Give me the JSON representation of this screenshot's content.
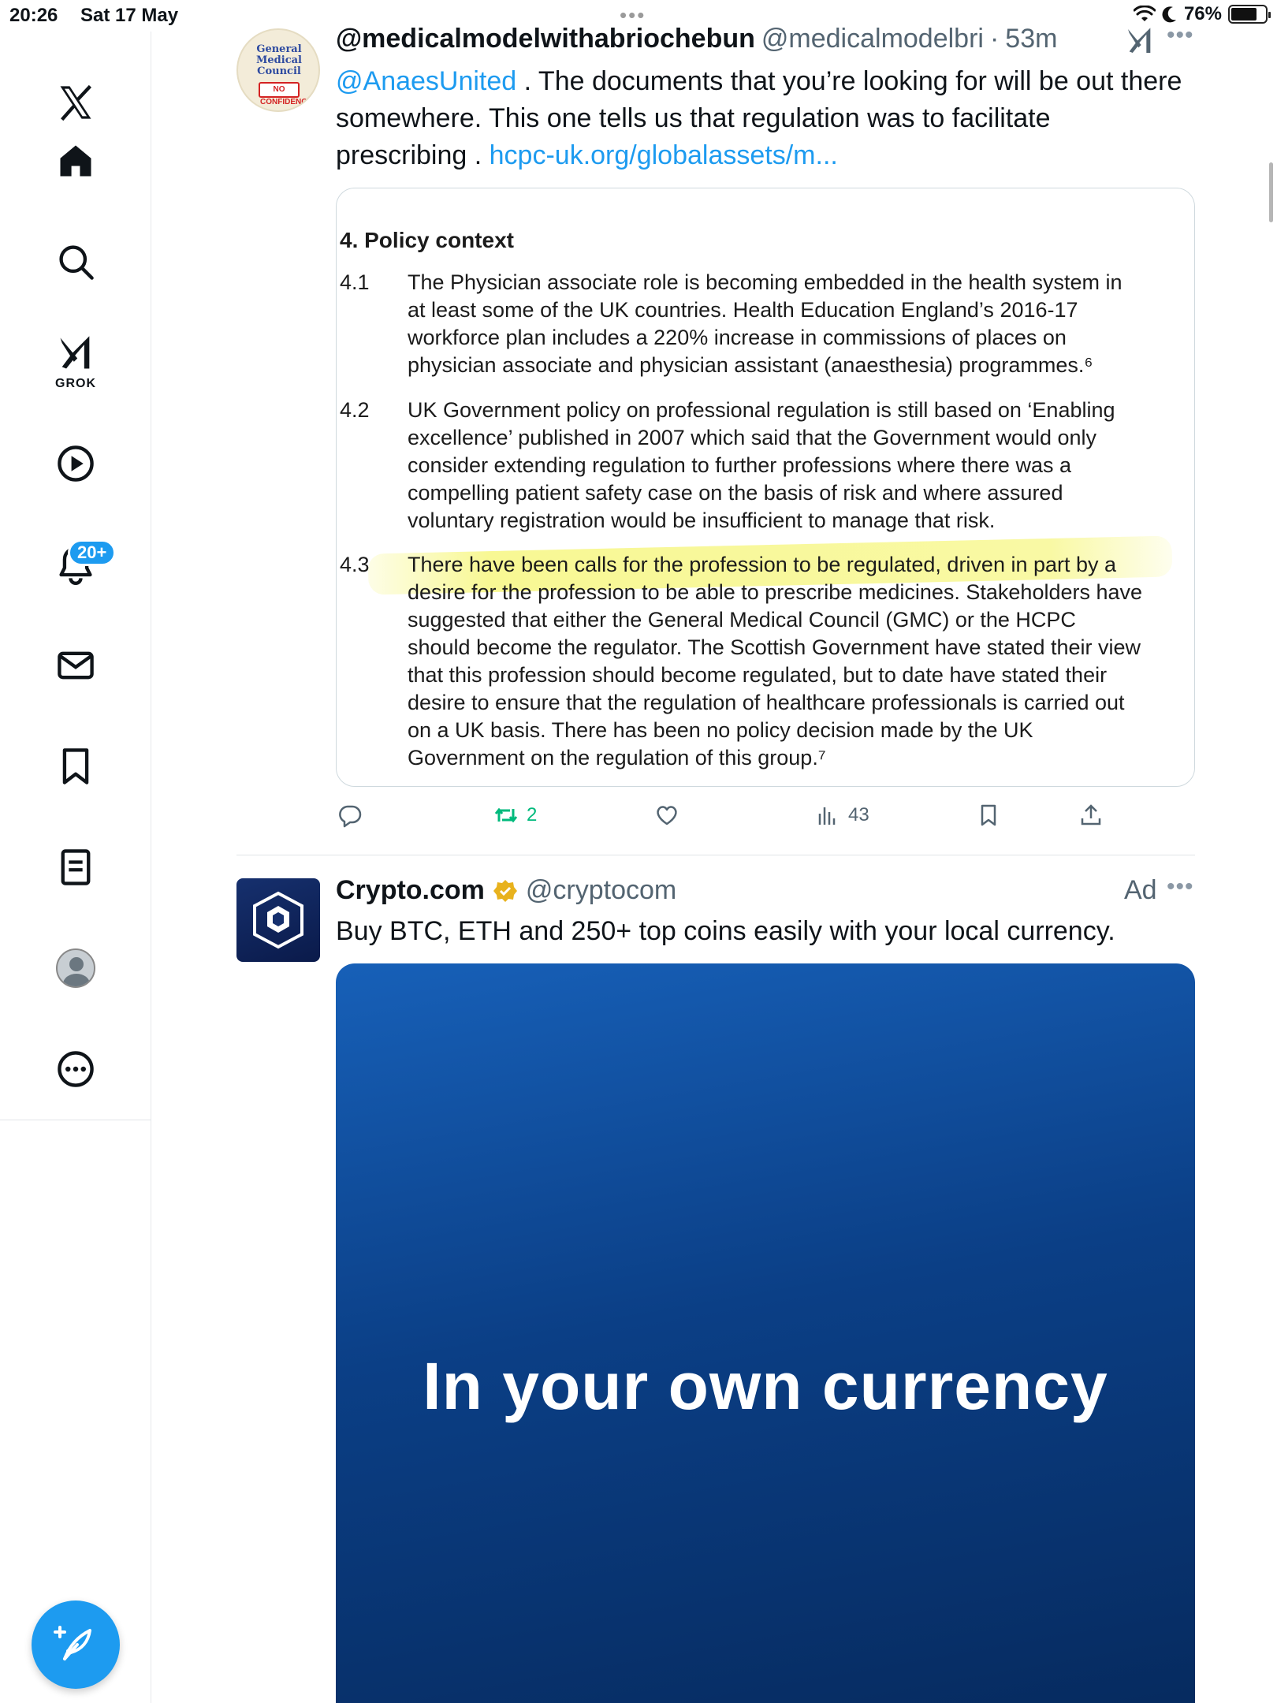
{
  "status_bar": {
    "time": "20:26",
    "date": "Sat 17 May",
    "battery": "76%",
    "battery_level": 0.76
  },
  "sidebar": {
    "items": [
      {
        "name": "x-logo",
        "label": ""
      },
      {
        "name": "home",
        "label": ""
      },
      {
        "name": "explore",
        "label": ""
      },
      {
        "name": "grok",
        "label": "GROK"
      },
      {
        "name": "video",
        "label": ""
      },
      {
        "name": "notifications",
        "label": ""
      },
      {
        "name": "messages",
        "label": ""
      },
      {
        "name": "bookmarks",
        "label": ""
      },
      {
        "name": "lists",
        "label": ""
      },
      {
        "name": "profile",
        "label": ""
      },
      {
        "name": "more",
        "label": ""
      }
    ],
    "grok_label": "GROK",
    "notifications_badge": "20+",
    "compose_icon": "compose-feather-icon"
  },
  "post1": {
    "display_name": "@medicalmodelwithabriochebun",
    "handle": "@medicalmodelbri",
    "separator": "·",
    "time": "53m",
    "avatar_text": {
      "line1": "General",
      "line2": "Medical",
      "line3": "Council",
      "stamp": "NO CONFIDENCE"
    },
    "text_mention": "@AnaesUnited",
    "text_line1_rest": " . The documents that you’re looking for will be out there",
    "text_line2": "somewhere. This one tells us that regulation was to facilitate",
    "text_line3_start": "prescribing . ",
    "text_link": "hcpc-uk.org/globalassets/m...",
    "document": {
      "heading": "4. Policy context",
      "paragraphs": [
        {
          "num": "4.1",
          "lines": [
            "The Physician associate role is becoming embedded in the health system in",
            "at least some of the UK countries. Health Education England’s 2016-17",
            "workforce plan includes a 220% increase in commissions of places on",
            "physician associate and physician assistant (anaesthesia) programmes.⁶"
          ]
        },
        {
          "num": "4.2",
          "lines": [
            "UK Government policy on professional regulation is still based on ‘Enabling",
            "excellence’ published in 2007 which said that the Government would only",
            "consider extending regulation to further professions where there was a",
            "compelling patient safety case on the basis of risk and where assured",
            "voluntary registration would be insufficient to manage that risk."
          ]
        },
        {
          "num": "4.3",
          "lines": [
            "There have been calls for the profession to be regulated, driven in part by a",
            "desire for the profession to be able to prescribe medicines. Stakeholders have",
            "suggested that either the General Medical Council (GMC) or the HCPC",
            "should become the regulator. The Scottish Government have stated their view",
            "that this profession should become regulated, but to date have stated their",
            "desire to ensure that the regulation of healthcare professionals is carried out",
            "on a UK basis. There has been no policy decision made by the UK",
            "Government on the regulation of this group.⁷"
          ]
        }
      ]
    },
    "actions": {
      "reply_count": "",
      "retweet_count": "2",
      "like_count": "",
      "views_count": "43"
    }
  },
  "post2": {
    "display_name": "Crypto.com",
    "handle": "@cryptocom",
    "ad_label": "Ad",
    "text": "Buy BTC, ETH and 250+ top coins easily with your local currency.",
    "ad_headline": "In your own currency"
  },
  "colors": {
    "accent": "#1d9bf0",
    "retweet": "#00ba7c",
    "muted": "#536471",
    "verified_gold": "#e8b21d"
  }
}
